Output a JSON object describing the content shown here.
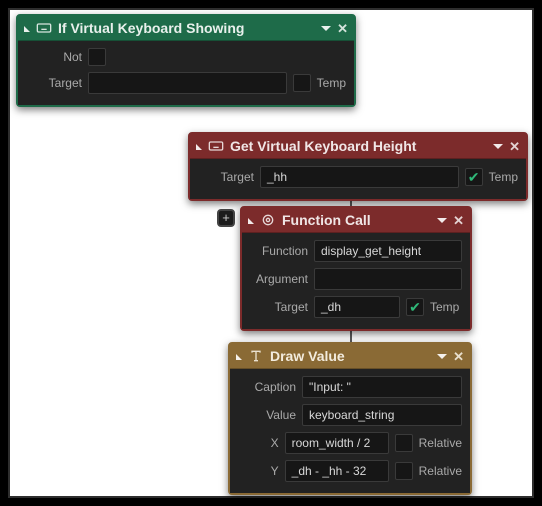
{
  "nodes": {
    "ifShowing": {
      "title": "If Virtual Keyboard Showing",
      "fields": {
        "not_label": "Not",
        "target_label": "Target",
        "target_value": "",
        "temp_label": "Temp",
        "temp_checked": false
      }
    },
    "getHeight": {
      "title": "Get Virtual Keyboard Height",
      "fields": {
        "target_label": "Target",
        "target_value": "_hh",
        "temp_label": "Temp",
        "temp_checked": true
      }
    },
    "fnCall": {
      "title": "Function Call",
      "fields": {
        "function_label": "Function",
        "function_value": "display_get_height",
        "argument_label": "Argument",
        "argument_value": "",
        "target_label": "Target",
        "target_value": "_dh",
        "temp_label": "Temp",
        "temp_checked": true
      }
    },
    "drawValue": {
      "title": "Draw Value",
      "fields": {
        "caption_label": "Caption",
        "caption_value": "\"Input: \"",
        "value_label": "Value",
        "value_value": "keyboard_string",
        "x_label": "X",
        "x_value": "room_width / 2",
        "x_relative": false,
        "y_label": "Y",
        "y_value": "_dh - _hh - 32",
        "y_relative": false,
        "relative_label": "Relative"
      }
    }
  },
  "addBtn": "+"
}
